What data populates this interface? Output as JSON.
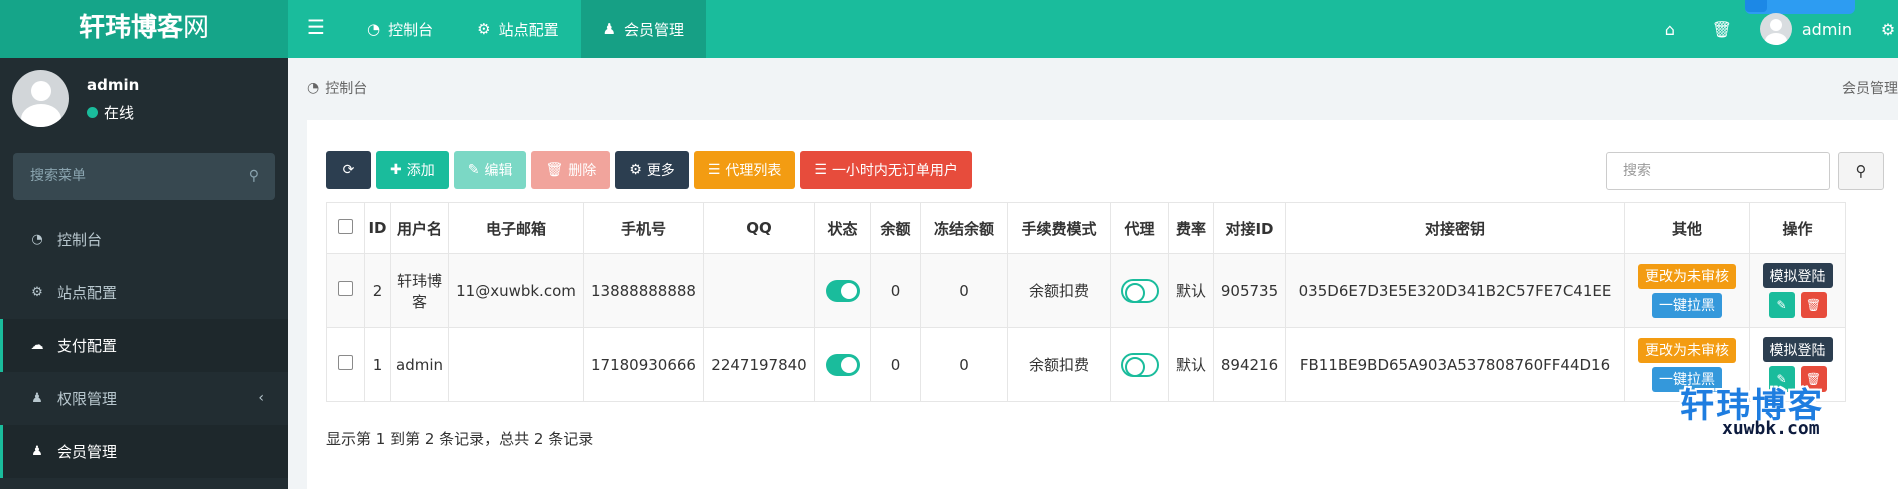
{
  "topbar": {
    "logo_main": "轩玮博客",
    "logo_suffix": "网",
    "nav": [
      {
        "label": "控制台",
        "icon": "dashboard-icon"
      },
      {
        "label": "站点配置",
        "icon": "gear-icon"
      },
      {
        "label": "会员管理",
        "icon": "user-icon"
      }
    ],
    "active_nav": "会员管理",
    "user": "admin"
  },
  "sidebar": {
    "user_name": "admin",
    "user_status": "在线",
    "search_placeholder": "搜索菜单",
    "items": [
      {
        "label": "控制台",
        "icon": "dashboard-icon"
      },
      {
        "label": "站点配置",
        "icon": "gear-icon"
      },
      {
        "label": "支付配置",
        "icon": "cloud-icon"
      },
      {
        "label": "权限管理",
        "icon": "users-icon"
      },
      {
        "label": "会员管理",
        "icon": "user-icon"
      }
    ]
  },
  "breadcrumb": {
    "left": "控制台",
    "right": "会员管理"
  },
  "toolbar": {
    "add": "添加",
    "edit": "编辑",
    "delete": "删除",
    "more": "更多",
    "agent_list": "代理列表",
    "no_order_users": "一小时内无订单用户",
    "search_placeholder": "搜索"
  },
  "table": {
    "headers": [
      "ID",
      "用户名",
      "电子邮箱",
      "手机号",
      "QQ",
      "状态",
      "余额",
      "冻结余额",
      "手续费模式",
      "代理",
      "费率",
      "对接ID",
      "对接密钥",
      "其他",
      "操作"
    ],
    "rows": [
      {
        "id": "2",
        "username": "轩玮博客",
        "email": "11@xuwbk.com",
        "phone": "13888888888",
        "qq": "",
        "status_on": true,
        "balance": "0",
        "frozen": "0",
        "fee_mode": "余额扣费",
        "agent_on": false,
        "rate": "默认",
        "api_id": "905735",
        "api_key": "035D6E7D3E5E320D341B2C57FE7C41EE"
      },
      {
        "id": "1",
        "username": "admin",
        "email": "",
        "phone": "17180930666",
        "qq": "2247197840",
        "status_on": true,
        "balance": "0",
        "frozen": "0",
        "fee_mode": "余额扣费",
        "agent_on": false,
        "rate": "默认",
        "api_id": "894216",
        "api_key": "FB11BE9BD65A903A537808760FF44D16"
      }
    ],
    "other_btn_review": "更改为未审核",
    "other_btn_block": "一键拉黑",
    "op_btn_login": "模拟登陆"
  },
  "pagination": {
    "info": "显示第 1 到第 2 条记录，总共 2 条记录"
  },
  "watermark": {
    "title": "轩玮博客",
    "sub": "xuwbk.com"
  },
  "colors": {
    "brand": "#1abc9c",
    "sidebar": "#222d32",
    "dark_button": "#2c3e50",
    "orange": "#f39c12",
    "red": "#e74c3c",
    "blue": "#3498db"
  }
}
